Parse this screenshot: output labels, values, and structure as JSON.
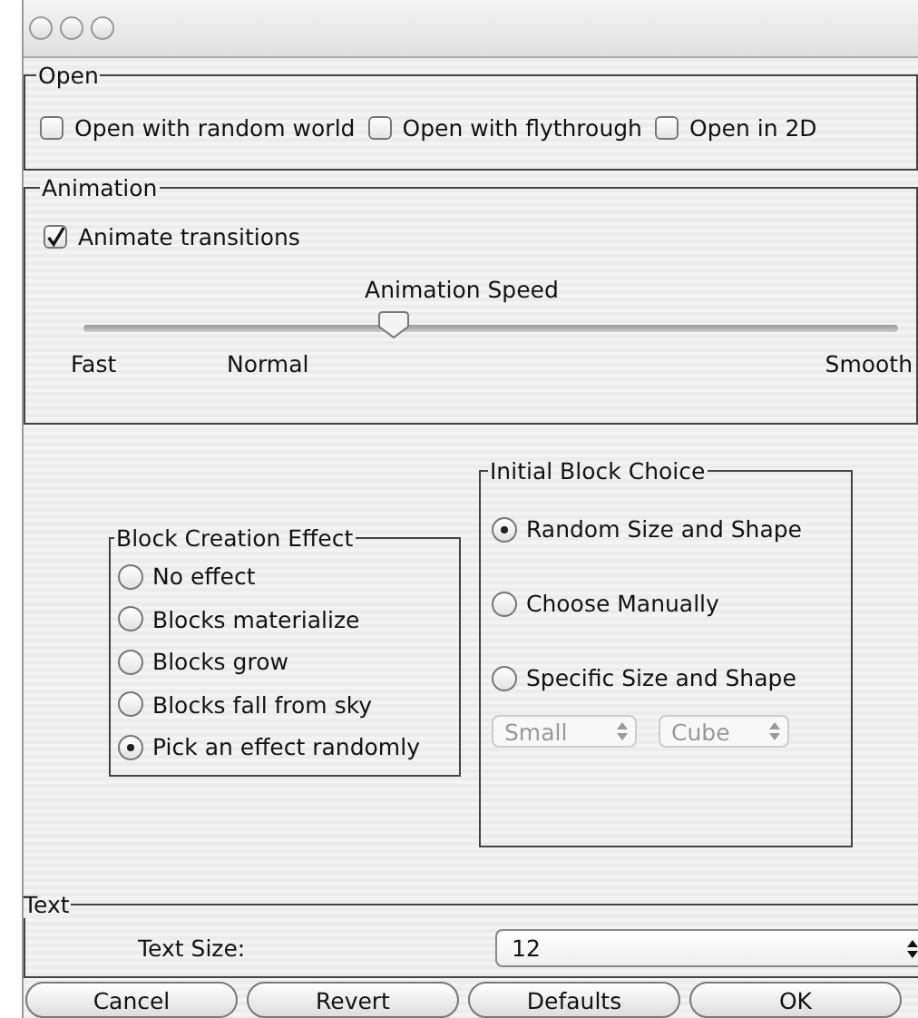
{
  "open": {
    "title": "Open",
    "options": [
      {
        "label": "Open with random world",
        "checked": false
      },
      {
        "label": "Open with flythrough",
        "checked": false
      },
      {
        "label": "Open in 2D",
        "checked": false
      }
    ]
  },
  "animation": {
    "title": "Animation",
    "animate": {
      "label": "Animate transitions",
      "checked": true
    },
    "speed": {
      "label": "Animation Speed",
      "level": 0.38,
      "ticks": [
        "Fast",
        "Normal",
        "Smooth"
      ]
    }
  },
  "block_creation_effect": {
    "title": "Block Creation Effect",
    "options": [
      {
        "label": "No effect",
        "selected": false
      },
      {
        "label": "Blocks materialize",
        "selected": false
      },
      {
        "label": "Blocks grow",
        "selected": false
      },
      {
        "label": "Blocks fall from sky",
        "selected": false
      },
      {
        "label": "Pick an effect randomly",
        "selected": true
      }
    ]
  },
  "initial_block_choice": {
    "title": "Initial Block Choice",
    "options": [
      {
        "label": "Random Size and Shape",
        "selected": true
      },
      {
        "label": "Choose Manually",
        "selected": false
      },
      {
        "label": "Specific Size and Shape",
        "selected": false
      }
    ],
    "dropdowns": [
      {
        "value": "Small",
        "disabled": true
      },
      {
        "value": "Cube",
        "disabled": true
      }
    ]
  },
  "text": {
    "title": "Text",
    "size_label": "Text Size:",
    "size_value": "12"
  },
  "buttons": [
    "Cancel",
    "Revert",
    "Defaults",
    "OK"
  ]
}
